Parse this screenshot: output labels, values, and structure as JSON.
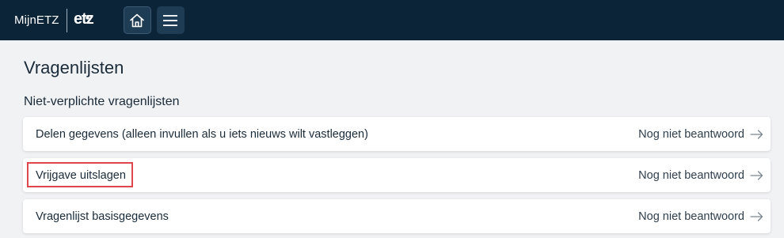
{
  "header": {
    "brand_text": "MijnETZ",
    "logo_text": "etz",
    "home_icon": "home-icon",
    "menu_icon": "hamburger-menu-icon",
    "background_color": "#0c2438"
  },
  "page": {
    "title": "Vragenlijsten",
    "section_title": "Niet-verplichte vragenlijsten"
  },
  "questionnaires": [
    {
      "label": "Delen gegevens (alleen invullen als u iets nieuws wilt vastleggen)",
      "status": "Nog niet beantwoord"
    },
    {
      "label": "Vrijgave uitslagen",
      "status": "Nog niet beantwoord"
    },
    {
      "label": "Vragenlijst basisgegevens",
      "status": "Nog niet beantwoord"
    }
  ],
  "highlight_color": "#e0474c"
}
